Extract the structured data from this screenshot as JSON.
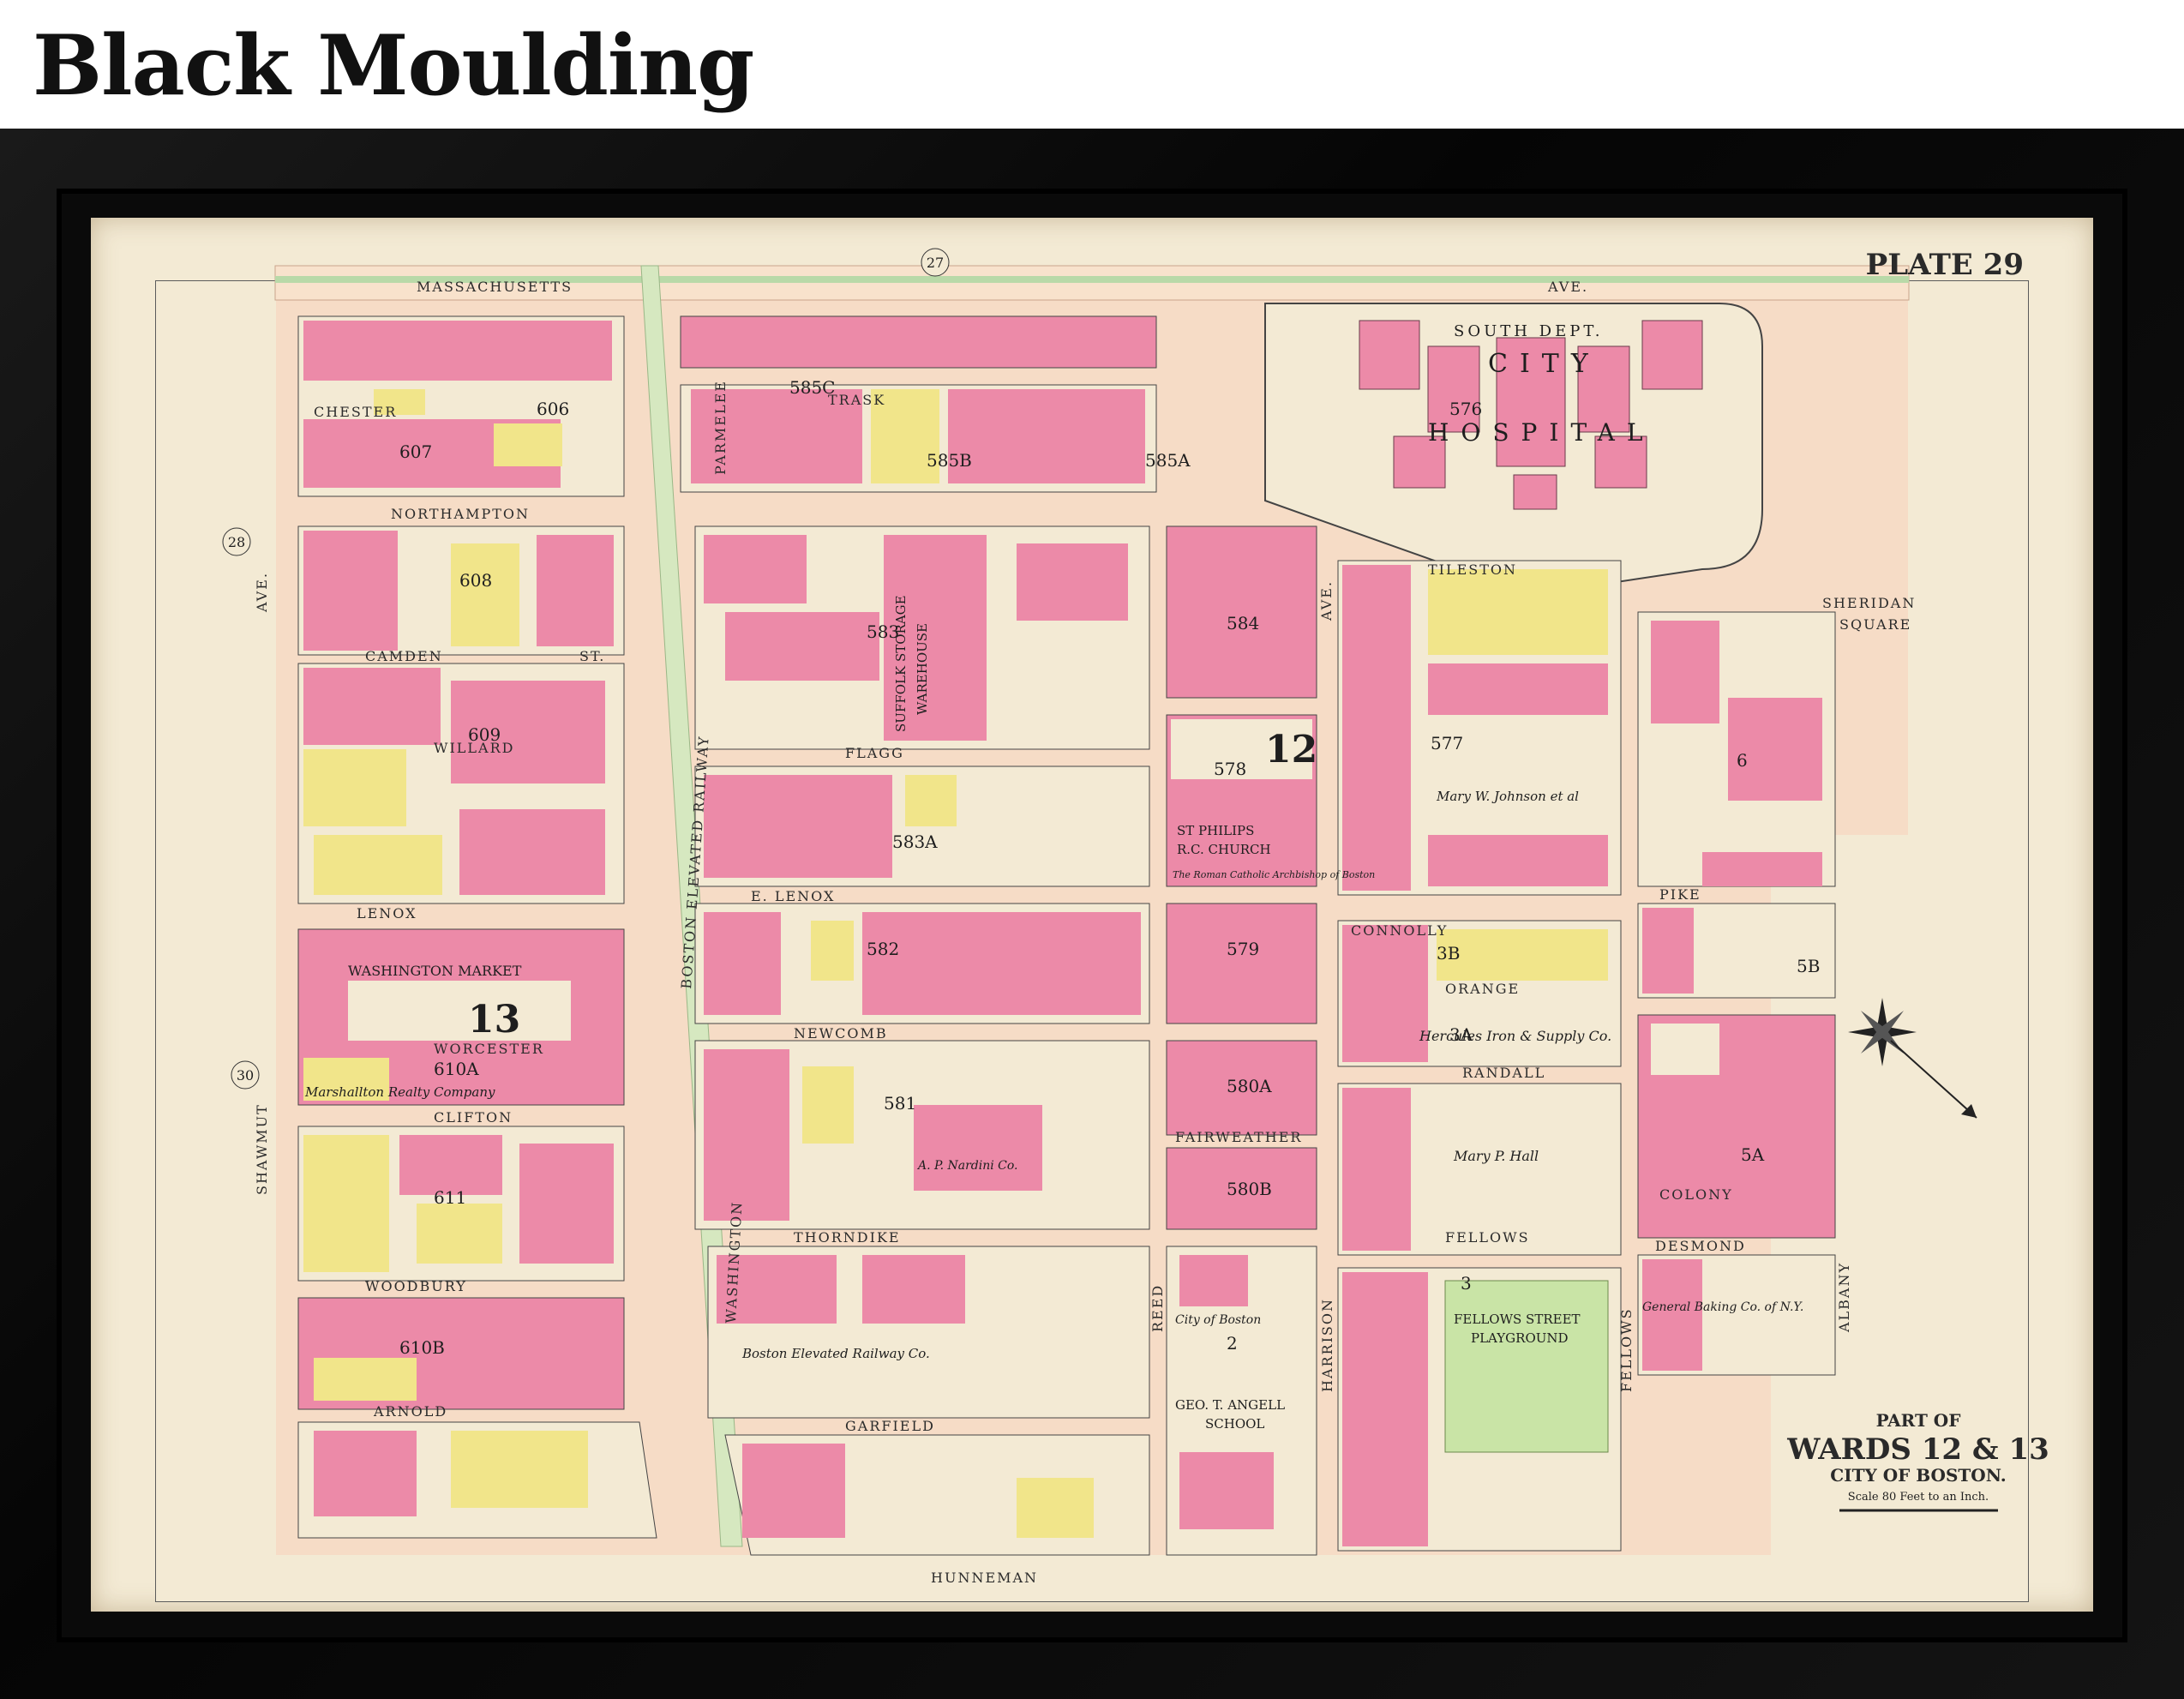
{
  "header": {
    "title": "Black Moulding"
  },
  "map": {
    "plate": "PLATE 29",
    "cartouche": {
      "line1": "PART OF",
      "line2": "WARDS 12 & 13",
      "line3": "CITY OF BOSTON.",
      "scale": "Scale 80 Feet to an Inch."
    },
    "adjacent_plates": [
      "27",
      "28",
      "30"
    ],
    "wards": [
      "13",
      "12",
      "13"
    ],
    "streets": {
      "massachusetts": "MASSACHUSETTS",
      "ave": "AVE.",
      "northampton": "NORTHAMPTON",
      "chester": "CHESTER",
      "camden": "CAMDEN",
      "st": "ST.",
      "willard": "WILLARD",
      "lenox": "LENOX",
      "e_lenox": "E. LENOX",
      "worcester": "WORCESTER",
      "clifton": "CLIFTON",
      "woodbury": "WOODBURY",
      "arnold": "ARNOLD",
      "shawmut": "SHAWMUT",
      "washington": "WASHINGTON",
      "flagg": "FLAGG",
      "newcomb": "NEWCOMB",
      "thorndike": "THORNDIKE",
      "fairweather": "FAIRWEATHER",
      "garfield": "GARFIELD",
      "hunneman": "HUNNEMAN",
      "reed": "REED",
      "harrison": "HARRISON",
      "tileston": "TILESTON",
      "connolly": "CONNOLLY",
      "orange": "ORANGE",
      "randall": "RANDALL",
      "fellows": "FELLOWS",
      "desmond": "DESMOND",
      "colony": "COLONY",
      "pike": "PIKE",
      "albany": "ALBANY",
      "sheridan": "SHERIDAN",
      "square": "SQUARE",
      "trask": "TRASK",
      "parmelee": "PARMELEE",
      "boston_elevated_railway": "BOSTON ELEVATED RAILWAY"
    },
    "landmarks": {
      "hospital_dept": "SOUTH DEPT.",
      "hospital_city": "CITY",
      "hospital_name": "HOSPITAL",
      "st_philips": "ST PHILIPS",
      "rc_church": "R.C. CHURCH",
      "washington_market": "WASHINGTON MARKET",
      "fellows_playground": "FELLOWS STREET",
      "playground": "PLAYGROUND",
      "school_name": "GEO. T. ANGELL",
      "school": "SCHOOL",
      "suffolk_storage": "SUFFOLK STORAGE",
      "warehouse": "WAREHOUSE"
    },
    "owners": {
      "hercules": "Hercules Iron & Supply Co.",
      "bery": "Boston Elevated Railway Co.",
      "nardini": "A. P. Nardini Co.",
      "general_baking": "General Baking Co. of N.Y.",
      "mary_hall": "Mary P. Hall",
      "mary_johnson": "Mary W. Johnson et al",
      "city_of_boston": "City of Boston",
      "marshallton": "Marshallton Realty Company",
      "roman_catholic": "The Roman Catholic Archbishop of Boston"
    },
    "block_numbers": [
      "606",
      "607",
      "608",
      "609",
      "610A",
      "610B",
      "611",
      "583",
      "583A",
      "584",
      "578",
      "579",
      "580A",
      "580B",
      "581",
      "582",
      "585A",
      "585B",
      "585C",
      "576",
      "577",
      "3A",
      "3B",
      "5A",
      "5B",
      "6",
      "2",
      "3"
    ]
  },
  "colors": {
    "paper": "#f3ead4",
    "brick_pink": "#ec8aa8",
    "wood_yellow": "#f1e58a",
    "park_green": "#c9e4a6",
    "street": "#f7e6d2",
    "frame": "#0c0c0c"
  }
}
